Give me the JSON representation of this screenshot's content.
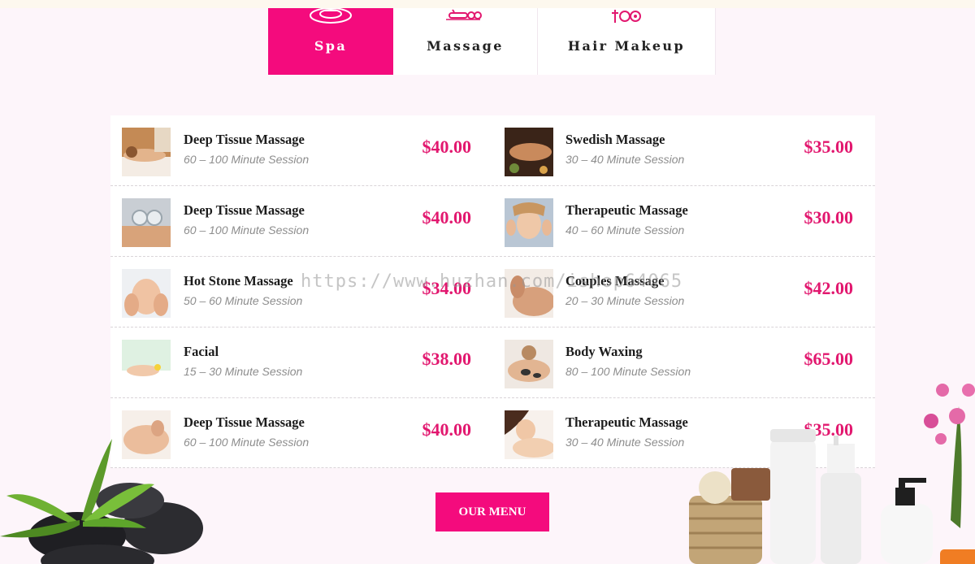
{
  "tabs": [
    {
      "label": "Spa",
      "icon": "spa-bowl-icon",
      "active": true
    },
    {
      "label": "Massage",
      "icon": "massage-tools-icon",
      "active": false
    },
    {
      "label": "Hair Makeup",
      "icon": "hair-makeup-icon",
      "active": false
    }
  ],
  "menu": {
    "items": [
      {
        "name": "Deep Tissue Massage",
        "duration": "60 – 100 Minute Session",
        "price": "$40.00",
        "image": "massage-back-photo"
      },
      {
        "name": "Swedish Massage",
        "duration": "30 – 40 Minute Session",
        "price": "$35.00",
        "image": "swedish-massage-photo"
      },
      {
        "name": "Deep Tissue Massage",
        "duration": "60 – 100 Minute Session",
        "price": "$40.00",
        "image": "cupping-photo"
      },
      {
        "name": "Therapeutic Massage",
        "duration": "40 – 60 Minute Session",
        "price": "$30.00",
        "image": "face-massage-photo"
      },
      {
        "name": "Hot Stone Massage",
        "duration": "50 – 60 Minute Session",
        "price": "$34.00",
        "image": "foot-massage-photo"
      },
      {
        "name": "Couples Massage",
        "duration": "20 – 30 Minute Session",
        "price": "$42.00",
        "image": "shoulder-massage-photo"
      },
      {
        "name": "Facial",
        "duration": "15 – 30 Minute Session",
        "price": "$38.00",
        "image": "facial-photo"
      },
      {
        "name": "Body Waxing",
        "duration": "80 – 100 Minute Session",
        "price": "$65.00",
        "image": "hot-stone-photo"
      },
      {
        "name": "Deep Tissue Massage",
        "duration": "60 – 100 Minute Session",
        "price": "$40.00",
        "image": "back-rub-photo"
      },
      {
        "name": "Therapeutic Massage",
        "duration": "30 – 40 Minute Session",
        "price": "$35.00",
        "image": "relaxing-woman-photo"
      }
    ],
    "button_label": "OUR MENU"
  },
  "watermark": "https://www.huzhan.com/ishop64065",
  "colors": {
    "accent": "#f40b7d",
    "price": "#e2186f",
    "background": "#fdf5fa"
  }
}
